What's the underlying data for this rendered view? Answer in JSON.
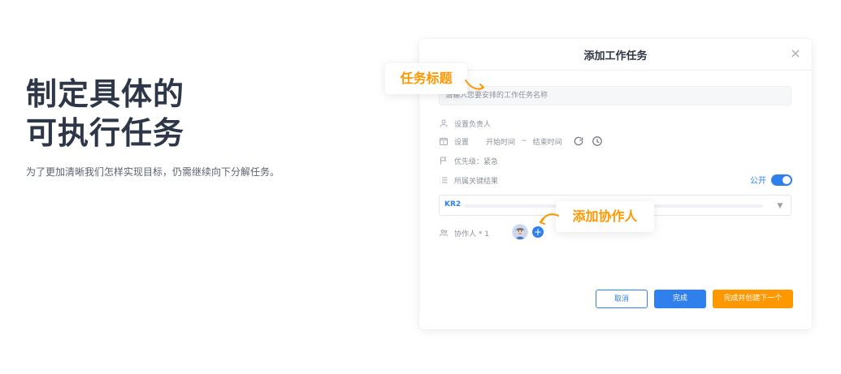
{
  "hero": {
    "title_line1": "制定具体的",
    "title_line2": "可执行任务",
    "description": "为了更加清晰我们怎样实现目标，仍需继续向下分解任务。"
  },
  "callouts": {
    "task_title": "任务标题",
    "add_collaborator": "添加协作人"
  },
  "dialog": {
    "title": "添加工作任务",
    "task_name_placeholder": "请输入您要安排的工作任务名称",
    "assignee_label": "设置负责人",
    "set_label": "设置",
    "start_time": "开始时间",
    "time_separator": "~",
    "end_time": "结束时间",
    "priority_label": "优先级：紧急",
    "key_result_label": "所属关键结果",
    "public_label": "公开",
    "kr_value": "KR2",
    "collaborators_label": "协作人 * 1",
    "buttons": {
      "cancel": "取消",
      "done": "完成",
      "done_create_next": "完成并创建下一个"
    }
  },
  "colors": {
    "accent": "#2f80ed",
    "orange": "#ff9800",
    "text": "#2f3542"
  },
  "icons": {
    "assignee": "user-icon",
    "calendar": "calendar-icon",
    "priority": "flag-icon",
    "key_result": "list-icon",
    "collaborators": "users-icon",
    "refresh": "refresh-icon",
    "clock": "clock-icon",
    "close": "close-icon",
    "avatar": "avatar-icon",
    "add": "plus-icon"
  }
}
